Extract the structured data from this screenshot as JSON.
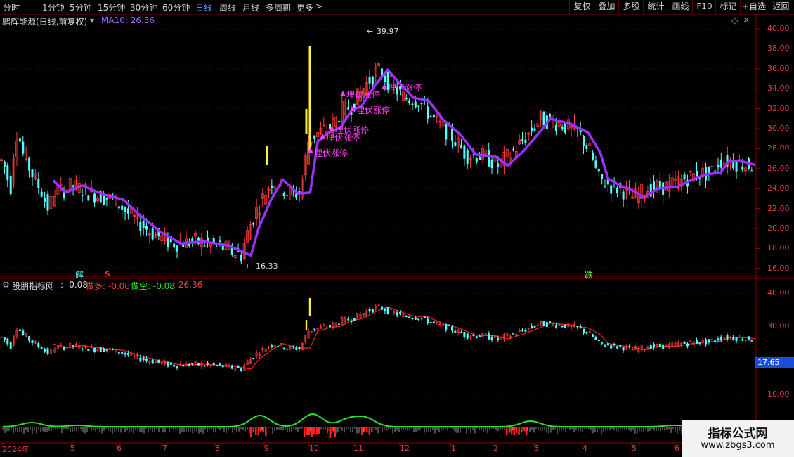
{
  "toolbar": {
    "periods": [
      "分时",
      "1分钟",
      "5分钟",
      "15分钟",
      "30分钟",
      "60分钟",
      "日线",
      "周线",
      "月线",
      "多周期",
      "更多"
    ],
    "active_period": "日线",
    "more_arrow": ">",
    "right_buttons": [
      "复权",
      "叠加",
      "多股",
      "统计",
      "画线",
      "F10",
      "标记",
      "+自选",
      "返回"
    ]
  },
  "main_chart": {
    "stock_title": "鹏辉能源(日线,前复权)",
    "ma_label": "MA10: 26.36",
    "high_label": "39.97",
    "low_label": "16.33",
    "signal_text": "埋伏涨停",
    "marker_left_1": "解",
    "marker_left_2": "≶",
    "marker_right": "跌",
    "diamond": "◇",
    "y_ticks": [
      "40.00",
      "38.00",
      "36.00",
      "34.00",
      "32.00",
      "30.00",
      "28.00",
      "26.00",
      "24.00",
      "22.00",
      "20.00",
      "18.00",
      "16.00"
    ]
  },
  "sub_chart": {
    "indicator_name": "股朋指标网",
    "value": ": -0.08",
    "long_label": "做多: -0.06",
    "short_label": "做空: -0.08",
    "extra_value": ": 26.36",
    "y_ticks": [
      "40.00",
      "30.00",
      "10.00"
    ],
    "cursor_value": "17.65"
  },
  "x_axis": {
    "labels": [
      "2024年",
      "5",
      "6",
      "7",
      "8",
      "9",
      "10",
      "11",
      "12",
      "1",
      "2",
      "3",
      "4",
      "5",
      "6"
    ]
  },
  "watermark": {
    "line1": "指标公式网",
    "line2": "www.zbgs3.com"
  },
  "colors": {
    "up": "#ff3c3c",
    "down": "#54ffff",
    "ma": "#9b30ff",
    "signal": "#ff40ff",
    "green_line": "#2ee02e",
    "active": "#5aa0ff"
  },
  "chart_data": {
    "type": "candlestick",
    "ma_series": [
      {
        "x": "2024-04-12",
        "y": 24.8
      },
      {
        "x": "2024-04-20",
        "y": 23.6
      },
      {
        "x": "2024-05-01",
        "y": 24.3
      },
      {
        "x": "2024-05-15",
        "y": 23.4
      },
      {
        "x": "2024-05-28",
        "y": 22.9
      },
      {
        "x": "2024-06-08",
        "y": 21.3
      },
      {
        "x": "2024-06-22",
        "y": 19.6
      },
      {
        "x": "2024-07-05",
        "y": 18.5
      },
      {
        "x": "2024-07-20",
        "y": 18.7
      },
      {
        "x": "2024-08-05",
        "y": 18.3
      },
      {
        "x": "2024-08-20",
        "y": 17.3
      },
      {
        "x": "2024-08-25",
        "y": 20.0
      },
      {
        "x": "2024-09-02",
        "y": 22.8
      },
      {
        "x": "2024-09-10",
        "y": 24.9
      },
      {
        "x": "2024-09-20",
        "y": 23.5
      },
      {
        "x": "2024-09-28",
        "y": 23.6
      },
      {
        "x": "2024-10-03",
        "y": 28.7
      },
      {
        "x": "2024-10-10",
        "y": 29.6
      },
      {
        "x": "2024-10-18",
        "y": 30.1
      },
      {
        "x": "2024-10-25",
        "y": 31.8
      },
      {
        "x": "2024-11-01",
        "y": 32.3
      },
      {
        "x": "2024-11-10",
        "y": 34.4
      },
      {
        "x": "2024-11-18",
        "y": 35.9
      },
      {
        "x": "2024-11-25",
        "y": 34.7
      },
      {
        "x": "2024-12-05",
        "y": 33.1
      },
      {
        "x": "2024-12-15",
        "y": 32.8
      },
      {
        "x": "2024-12-25",
        "y": 30.8
      },
      {
        "x": "2025-01-05",
        "y": 29.4
      },
      {
        "x": "2025-01-15",
        "y": 27.4
      },
      {
        "x": "2025-01-28",
        "y": 27.2
      },
      {
        "x": "2025-02-05",
        "y": 26.3
      },
      {
        "x": "2025-02-15",
        "y": 27.7
      },
      {
        "x": "2025-02-28",
        "y": 30.0
      },
      {
        "x": "2025-03-05",
        "y": 31.0
      },
      {
        "x": "2025-03-18",
        "y": 30.5
      },
      {
        "x": "2025-03-30",
        "y": 29.6
      },
      {
        "x": "2025-04-07",
        "y": 27.6
      },
      {
        "x": "2025-04-12",
        "y": 25.0
      },
      {
        "x": "2025-04-20",
        "y": 24.3
      },
      {
        "x": "2025-04-30",
        "y": 23.7
      },
      {
        "x": "2025-05-05",
        "y": 23.1
      },
      {
        "x": "2025-05-15",
        "y": 24.0
      },
      {
        "x": "2025-05-28",
        "y": 24.2
      },
      {
        "x": "2025-06-05",
        "y": 24.8
      },
      {
        "x": "2025-06-15",
        "y": 25.4
      },
      {
        "x": "2025-06-25",
        "y": 25.6
      },
      {
        "x": "2025-07-01",
        "y": 26.8
      },
      {
        "x": "2025-07-10",
        "y": 26.7
      },
      {
        "x": "2025-07-18",
        "y": 26.36
      }
    ],
    "high": 39.97,
    "low": 16.33,
    "ylim": [
      15.5,
      41
    ]
  }
}
